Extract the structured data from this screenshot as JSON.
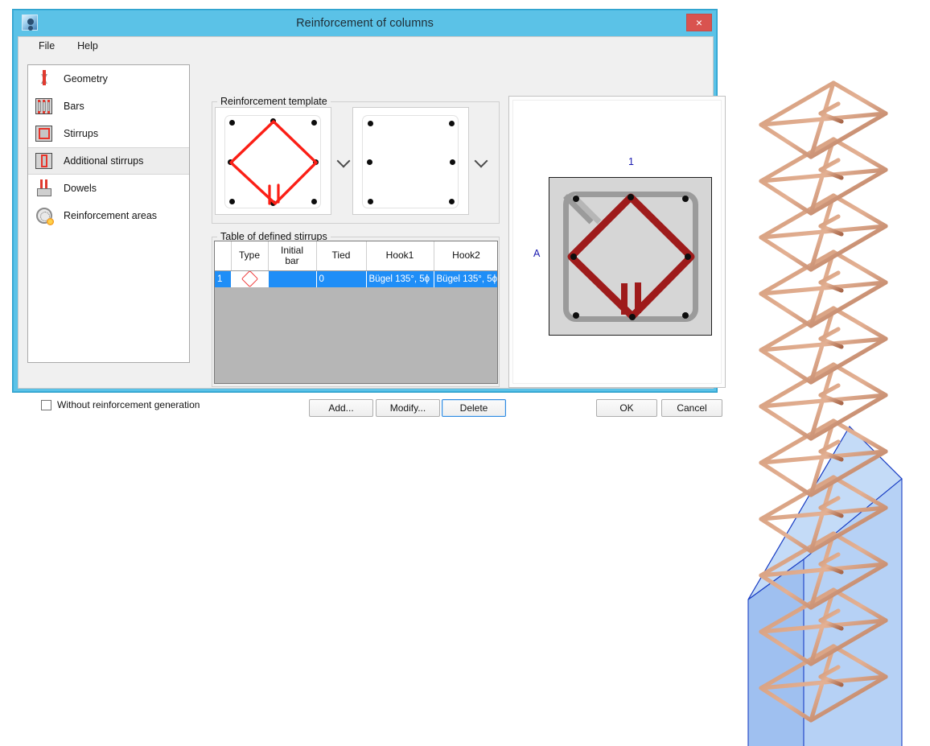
{
  "window": {
    "title": "Reinforcement of columns",
    "close_label": "×",
    "app_icon": "user-avatar-icon",
    "accent_titlebar_color": "#5bc2e7",
    "close_button_color": "#d9534f"
  },
  "menu": {
    "items": [
      {
        "label": "File"
      },
      {
        "label": "Help"
      }
    ]
  },
  "sidebar": {
    "items": [
      {
        "label": "Geometry",
        "icon": "geometry-icon",
        "selected": false
      },
      {
        "label": "Bars",
        "icon": "bars-icon",
        "selected": false
      },
      {
        "label": "Stirrups",
        "icon": "stirrups-icon",
        "selected": false
      },
      {
        "label": "Additional stirrups",
        "icon": "additional-stirrups-icon",
        "selected": true
      },
      {
        "label": "Dowels",
        "icon": "dowels-icon",
        "selected": false
      },
      {
        "label": "Reinforcement areas",
        "icon": "reinforcement-areas-icon",
        "selected": false
      }
    ]
  },
  "template_group": {
    "label": "Reinforcement template",
    "cards": [
      {
        "name": "diamond-stirrup-template",
        "selected": true,
        "dots": 8,
        "stirrup": "diamond"
      },
      {
        "name": "empty-template",
        "selected": false,
        "dots": 6,
        "stirrup": "none"
      }
    ],
    "dropdown_icon": "chevron-down-icon"
  },
  "table_group": {
    "label": "Table of defined stirrups",
    "columns": [
      "",
      "Type",
      "Initial bar",
      "Tied",
      "Hook1",
      "Hook2"
    ],
    "column_headers": {
      "index": "",
      "type": "Type",
      "initial_bar_line1": "Initial",
      "initial_bar_line2": "bar",
      "tied": "Tied",
      "hook1": "Hook1",
      "hook2": "Hook2"
    },
    "rows": [
      {
        "index": "1",
        "type_icon": "diamond-stirrup-icon",
        "initial_bar": "",
        "tied": "0",
        "hook1": "Bügel 135°, 5ϕ",
        "hook2": "Bügel 135°, 5ϕ",
        "selected": true
      }
    ],
    "selection_color": "#1f8ef7"
  },
  "preview": {
    "label_top": "1",
    "label_left": "A",
    "section_fill": "#d6d6d6",
    "main_stirrup_color": "#9b9b9b",
    "additional_stirrup_color": "#9e1b1b",
    "bar_count": 8
  },
  "footer": {
    "checkbox": {
      "label": "Without reinforcement generation",
      "checked": false
    },
    "buttons": [
      {
        "label": "Add...",
        "name": "add-button",
        "focused": false
      },
      {
        "label": "Modify...",
        "name": "modify-button",
        "focused": false
      },
      {
        "label": "Delete",
        "name": "delete-button",
        "focused": true
      },
      {
        "label": "OK",
        "name": "ok-button",
        "focused": false
      },
      {
        "label": "Cancel",
        "name": "cancel-button",
        "focused": false
      }
    ]
  },
  "viewport_3d": {
    "name": "column-reinforcement-3d-view",
    "concrete_color": "#aac8f0",
    "rebar_color": "#c98c6a",
    "outline_color": "#1b3fc4",
    "longitudinal_bars": 8,
    "stirrup_layers": 11
  }
}
